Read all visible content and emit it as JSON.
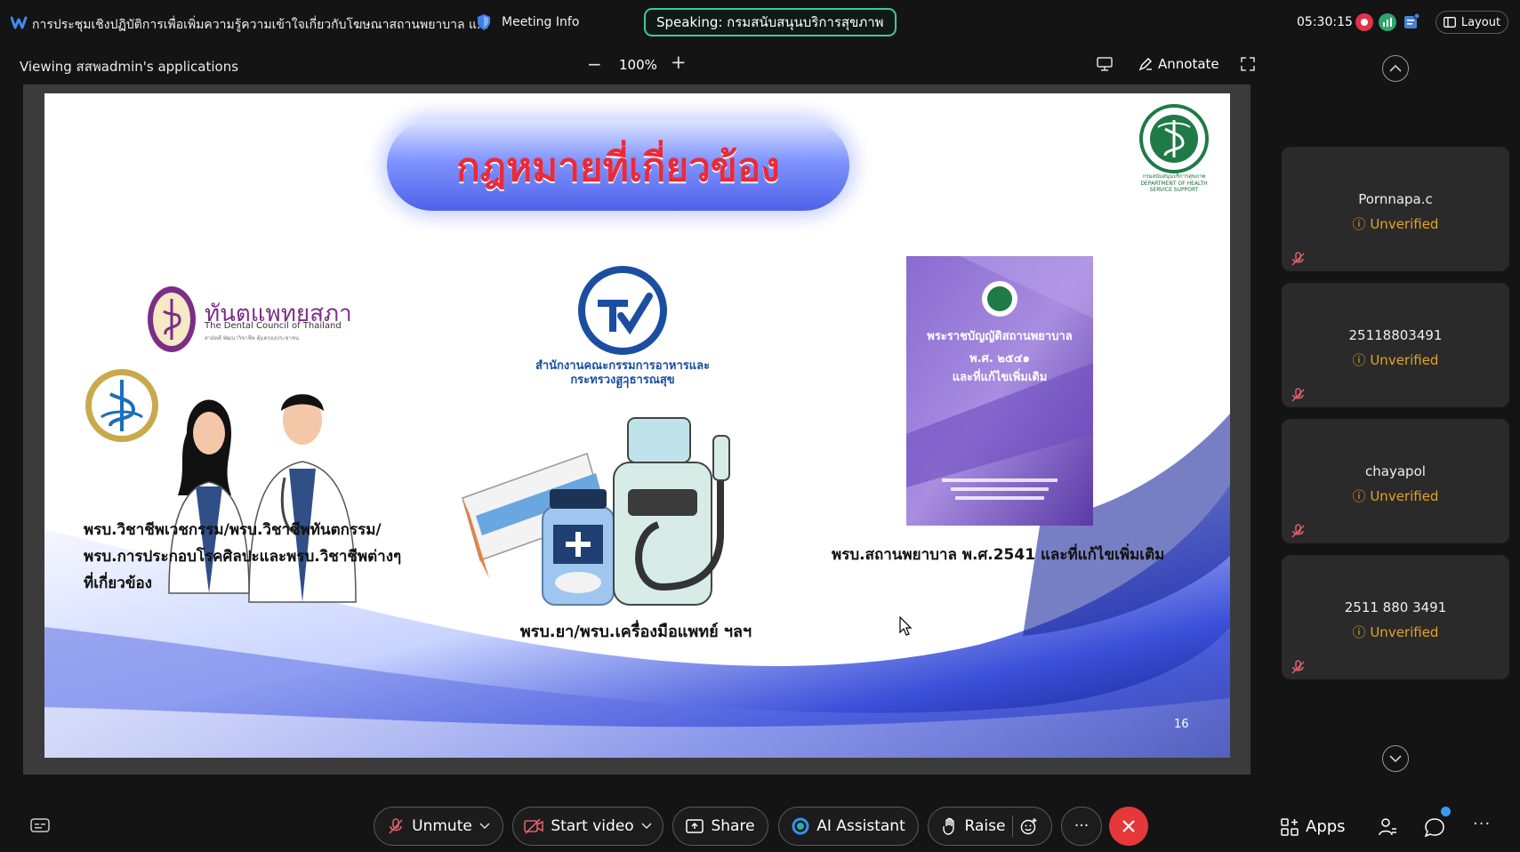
{
  "topbar": {
    "meeting_title": "การประชุมเชิงปฏิบัติการเพื่อเพิ่มความรู้ความเข้าใจเกี่ยวกับโฆษณาสถานพยาบาล แ...",
    "meeting_info_label": "Meeting Info",
    "speaking": "Speaking: กรมสนับสนุนบริการสุขภาพ",
    "clock": "05:30:15",
    "layout_label": "Layout"
  },
  "viewbar": {
    "viewing_text": "Viewing สสพadmin's applications",
    "zoom_minus": "−",
    "zoom_level": "100%",
    "zoom_plus": "+",
    "annotate_label": "Annotate"
  },
  "slide": {
    "title": "กฎหมายที่เกี่ยวข้อง",
    "moph_caption": "กรมสนับสนุนบริการสุขภาพ DEPARTMENT OF HEALTH SERVICE SUPPORT",
    "dental_name": "ทันตแพทยสภา",
    "dental_en": "The Dental Council of Thailand",
    "dental_sub": "สามัคคี พัฒนาวิชาชีพ คุ้มครองประชาชน",
    "law_1": "พรบ.วิชาชีพเวชกรรม/พรบ.วิชาชีพทันตกรรม/ พรบ.การประกอบโรคศิลปะและพรบ.วิชาชีพต่างๆ ที่เกี่ยวข้อง",
    "fda_line_1": "สำนักงานคณะกรรมการอาหารและยา",
    "fda_line_2": "กระทรวงสาธารณสุข",
    "law_2": "พรบ.ยา/พรบ.เครื่องมือแพทย์ ฯลฯ",
    "book_line_1": "พระราชบัญญัติสถานพยาบาล",
    "book_line_2": "พ.ศ. ๒๕๔๑",
    "book_line_3": "และที่แก้ไขเพิ่มเติม",
    "law_3": "พรบ.สถานพยาบาล พ.ศ.2541 และที่แก้ไขเพิ่มเติม",
    "page_number": "16"
  },
  "participants": [
    {
      "name": "Pornnapa.c",
      "status": "Unverified"
    },
    {
      "name": "25118803491",
      "status": "Unverified"
    },
    {
      "name": "chayapol",
      "status": "Unverified"
    },
    {
      "name": "2511 880 3491",
      "status": "Unverified"
    }
  ],
  "toolbar": {
    "unmute": "Unmute",
    "start_video": "Start video",
    "share": "Share",
    "ai_assistant": "AI Assistant",
    "raise": "Raise",
    "more": "···",
    "apps": "Apps",
    "more_right": "···"
  },
  "colors": {
    "background": "#141414",
    "speaking_border": "#3fc6a2",
    "unverified": "#e5a321",
    "end_call": "#e5383b",
    "slide_title": "#ea2a3a"
  }
}
